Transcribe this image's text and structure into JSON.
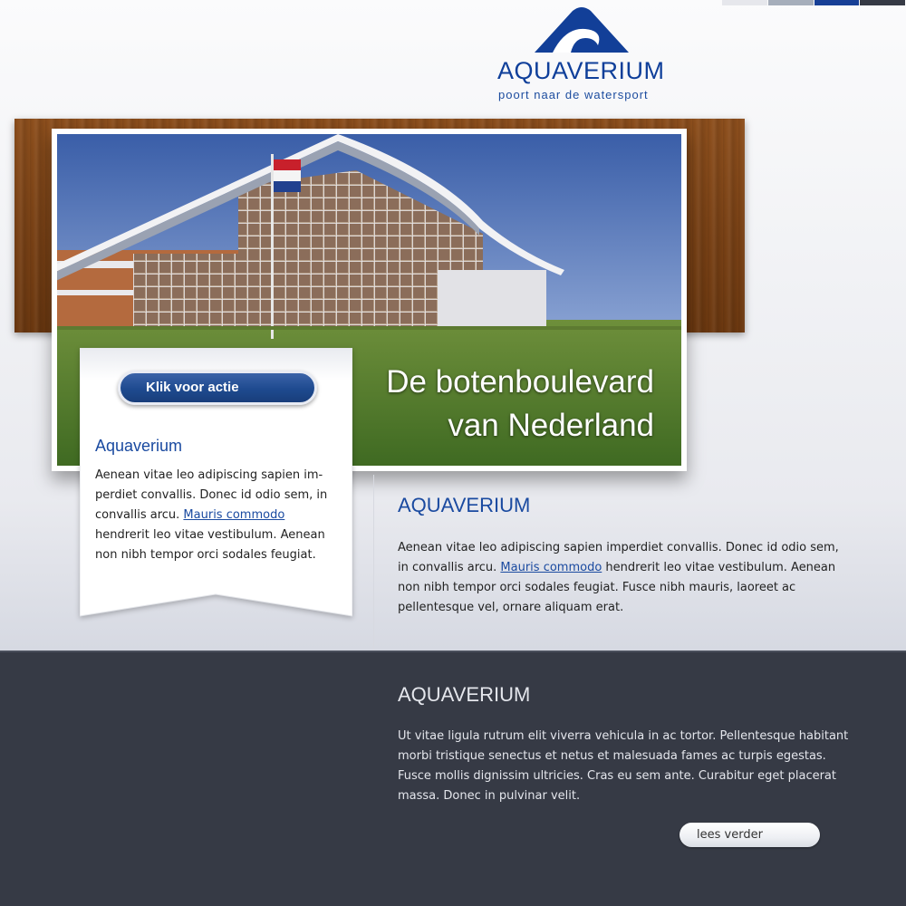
{
  "colors": {
    "brand_blue": "#0f3f9a",
    "link_blue": "#1a4aa0",
    "footer_bg": "#363a45",
    "swatches": [
      "#e6e7ec",
      "#a6aebb",
      "#173f96",
      "#363a45"
    ]
  },
  "brand": {
    "name": "AQUAVERIUM",
    "tagline": "poort naar de watersport",
    "logo_icon": "wave-icon"
  },
  "hero": {
    "headline_line1": "De botenboulevard",
    "headline_line2": "van Nederland"
  },
  "cta": {
    "label": "Klik voor actie"
  },
  "sidebar": {
    "title": "Aquaverium",
    "text_before_link": "Aenean vitae leo adipiscing sapien im-perdiet convallis. Donec id odio sem, in convallis arcu. ",
    "link_text": "Mauris commodo",
    "text_after_link": " hendrerit leo vitae vestibulum. Aenean non nibh tempor orci sodales feugiat."
  },
  "main": {
    "title": "AQUAVERIUM",
    "text_before_link": "Aenean vitae leo adipiscing sapien imperdiet convallis. Donec id odio sem, in convallis arcu. ",
    "link_text": "Mauris commodo",
    "text_after_link": " hendrerit leo vitae vestibulum. Aenean non nibh tempor orci sodales feugiat. Fusce nibh mauris, laoreet ac pellentesque vel, ornare aliquam erat."
  },
  "footer": {
    "title": "AQUAVERIUM",
    "text": "Ut vitae ligula rutrum elit viverra vehicula in ac tortor. Pellentesque habitant morbi tristique senectus et netus et malesuada fames ac turpis egestas. Fusce mollis dignissim ultricies. Cras eu sem ante. Curabitur eget placerat massa. Donec in pulvinar velit.",
    "read_more_label": "lees verder"
  }
}
